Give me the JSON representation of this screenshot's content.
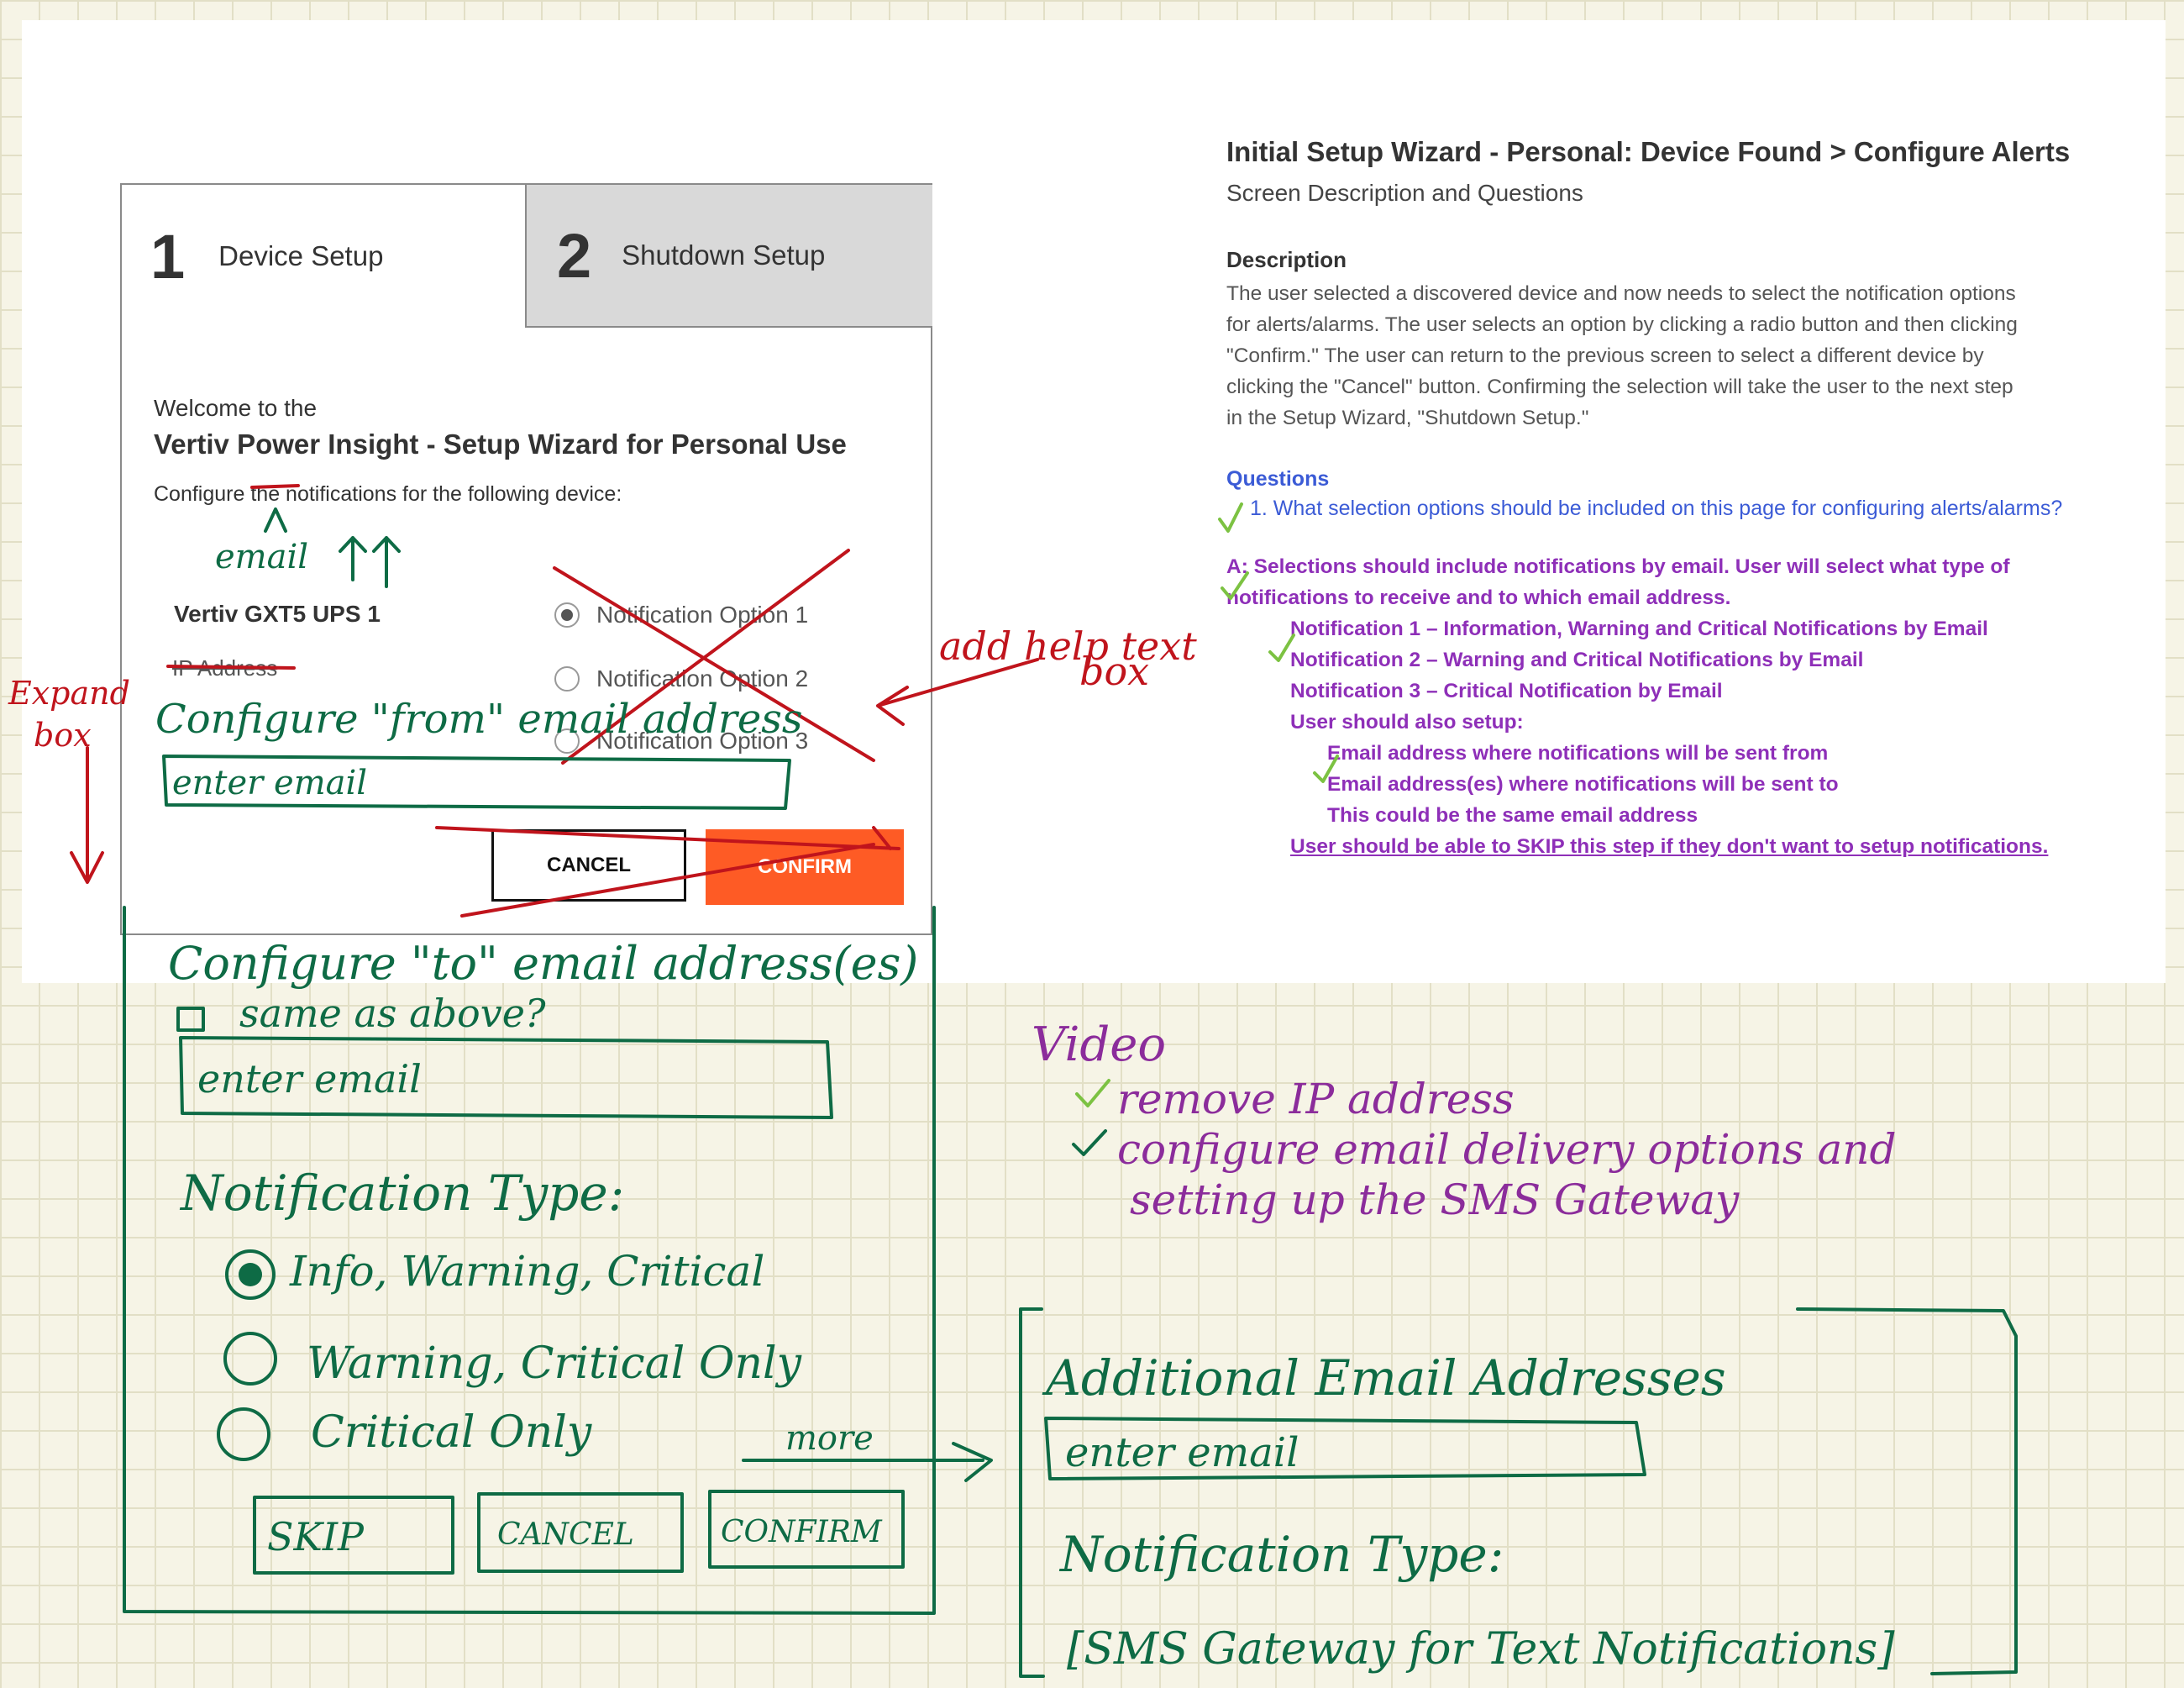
{
  "wizard": {
    "tabs": [
      {
        "number": "1",
        "label": "Device Setup"
      },
      {
        "number": "2",
        "label": "Shutdown Setup"
      }
    ],
    "welcome": "Welcome to the",
    "app_title": "Vertiv Power Insight - Setup Wizard for Personal Use",
    "configure_line": "Configure the notifications for the following device:",
    "device_name": "Vertiv GXT5 UPS 1",
    "ip_label": "IP Address",
    "options": [
      "Notification Option 1",
      "Notification Option 2",
      "Notification Option 3"
    ],
    "cancel_label": "CANCEL",
    "confirm_label": "CONFIRM"
  },
  "description_panel": {
    "heading": "Initial Setup Wizard - Personal: Device Found > Configure Alerts",
    "subheading": "Screen Description and Questions",
    "description_label": "Description",
    "description_lines": [
      "The user selected a discovered device and now needs to select the notification options",
      "for alerts/alarms.  The user selects an option by clicking a radio button and then clicking",
      "\"Confirm.\"  The user can return to the previous screen to select a different device by",
      "clicking the \"Cancel\" button.  Confirming the selection will take the user to the next step",
      "in the Setup Wizard, \"Shutdown Setup.\""
    ],
    "questions_label": "Questions",
    "question_1": "1.  What selection options should be included on this page for configuring alerts/alarms?",
    "answer_lines": [
      "A:  Selections should include notifications by email. User will select what type of",
      "notifications to receive and to which email address."
    ],
    "notification_items": [
      "Notification 1 – Information, Warning and Critical Notifications by Email",
      "Notification 2 – Warning and Critical Notifications by Email",
      "Notification 3 – Critical Notification by Email",
      "User should also setup:"
    ],
    "setup_items": [
      "Email address where notifications will be sent from",
      "Email address(es) where notifications will be sent to",
      "This could be the same email address"
    ],
    "skip_line": "User should be able to SKIP this step if they don't want to setup notifications."
  },
  "annotations": {
    "email_caret": "email",
    "expand_box": [
      "Expand",
      "box"
    ],
    "add_help_text": [
      "add help text",
      "box"
    ],
    "configure_from": "Configure \"from\" email address",
    "enter_email_1": "enter email",
    "configure_to": "Configure \"to\" email address(es)",
    "same_as_above": "same as above?",
    "enter_email_2": "enter email",
    "notification_type": "Notification Type:",
    "types": [
      "Info, Warning, Critical",
      "Warning, Critical Only",
      "Critical Only"
    ],
    "skip_btn": "SKIP",
    "cancel_btn": "CANCEL",
    "confirm_btn": "CONFIRM",
    "more": "more",
    "video_title": "Video",
    "video_items": [
      "remove IP address",
      "configure email delivery options and",
      "setting up the SMS Gateway"
    ],
    "additional_title": "Additional Email Addresses",
    "enter_email_3": "enter email",
    "notification_type_2": "Notification Type:",
    "sms_gateway": "[SMS Gateway for Text Notifications]"
  },
  "colors": {
    "green_ink": "#0e6b45",
    "red_ink": "#c0141c",
    "purple_ink": "#8b2c9b",
    "confirm_orange": "#fe5b25",
    "answer_purple": "#8e2fb8",
    "question_blue": "#3b5bd6",
    "check_green": "#7cc242"
  }
}
